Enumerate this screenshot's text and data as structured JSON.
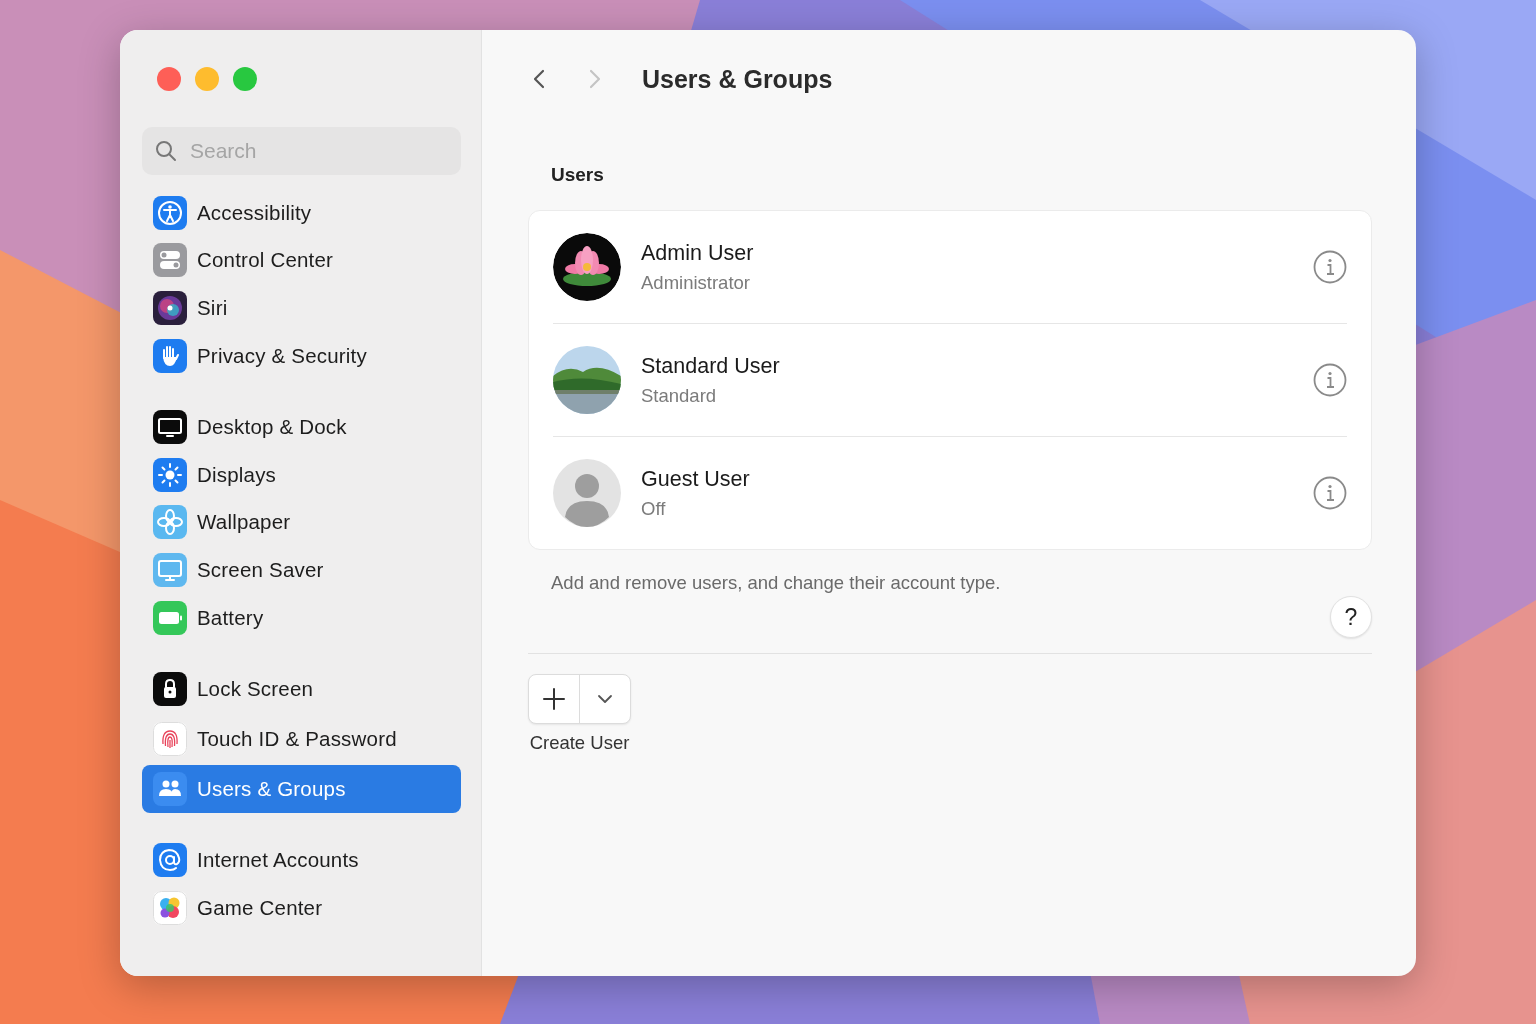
{
  "window": {
    "traffic_lights": [
      {
        "color": "#fe5f57"
      },
      {
        "color": "#febc2e"
      },
      {
        "color": "#28c840"
      }
    ]
  },
  "sidebar": {
    "search": {
      "placeholder": "Search"
    },
    "groups": [
      {
        "items": [
          {
            "label": "Accessibility",
            "selected": false
          },
          {
            "label": "Control Center",
            "selected": false
          },
          {
            "label": "Siri",
            "selected": false
          },
          {
            "label": "Privacy & Security",
            "selected": false
          }
        ]
      },
      {
        "items": [
          {
            "label": "Desktop & Dock",
            "selected": false
          },
          {
            "label": "Displays",
            "selected": false
          },
          {
            "label": "Wallpaper",
            "selected": false
          },
          {
            "label": "Screen Saver",
            "selected": false
          },
          {
            "label": "Battery",
            "selected": false
          }
        ]
      },
      {
        "items": [
          {
            "label": "Lock Screen",
            "selected": false
          },
          {
            "label": "Touch ID & Password",
            "selected": false
          },
          {
            "label": "Users & Groups",
            "selected": true
          }
        ]
      },
      {
        "items": [
          {
            "label": "Internet Accounts",
            "selected": false
          },
          {
            "label": "Game Center",
            "selected": false
          }
        ]
      }
    ]
  },
  "toolbar": {
    "back": {
      "disabled": false
    },
    "forward": {
      "disabled": true
    },
    "title": "Users & Groups"
  },
  "users_section": {
    "heading": "Users",
    "users": [
      {
        "name": "Admin User",
        "role": "Administrator",
        "kind": "picture"
      },
      {
        "name": "Standard User",
        "role": "Standard",
        "kind": "picture"
      },
      {
        "name": "Guest User",
        "role": "Off",
        "kind": "silhouette"
      }
    ],
    "description": "Add and remove users, and change their account type.",
    "help_label": "?"
  },
  "add_control": {
    "label": "Create User"
  }
}
